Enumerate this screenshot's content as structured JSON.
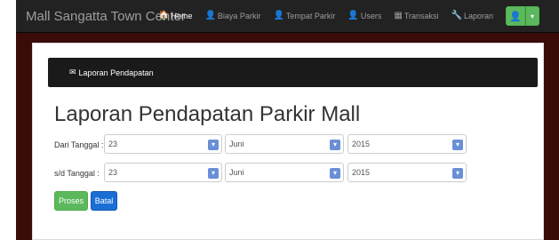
{
  "navbar": {
    "brand": "Mall Sangatta Town Center",
    "items": [
      {
        "label": "Home",
        "icon": "home-icon",
        "glyph": "🏠",
        "active": true
      },
      {
        "label": "Biaya Parkir",
        "icon": "user-icon",
        "glyph": "👤",
        "active": false
      },
      {
        "label": "Tempat Parkir",
        "icon": "user-icon",
        "glyph": "👤",
        "active": false
      },
      {
        "label": "Users",
        "icon": "user-icon",
        "glyph": "👤",
        "active": false
      },
      {
        "label": "Transaksi",
        "icon": "table-icon",
        "glyph": "▦",
        "active": false
      },
      {
        "label": "Laporan",
        "icon": "wrench-icon",
        "glyph": "🔧",
        "active": false
      }
    ],
    "user_button_icon": "user-icon",
    "user_button_glyph": "👤",
    "user_caret_glyph": "▾"
  },
  "panel": {
    "title": "Laporan Pendapatan",
    "icon": "envelope-icon",
    "glyph": "✉"
  },
  "page_title": "Laporan Pendapatan Parkir Mall",
  "form": {
    "from": {
      "label": "Dari Tanggal :",
      "day": "23",
      "month": "Juni",
      "year": "2015"
    },
    "to": {
      "label": "s/d Tanggal  :",
      "day": "23",
      "month": "Juni",
      "year": "2015"
    },
    "chevron_glyph": "▾",
    "process_label": "Proses",
    "cancel_label": "Batal"
  },
  "colors": {
    "navbar_bg": "#222222",
    "background_band": "#3a0b08",
    "success": "#5cb85c",
    "primary": "#1a6fd6"
  }
}
